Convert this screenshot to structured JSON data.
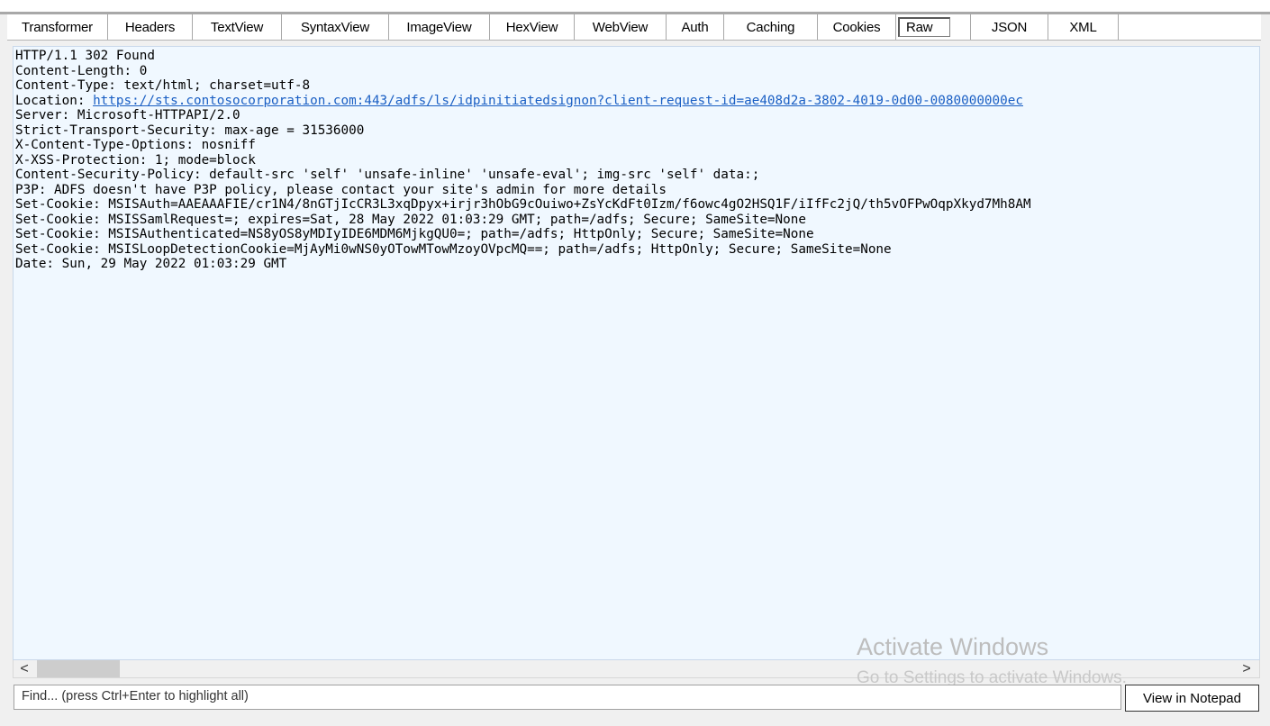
{
  "tabs": [
    {
      "label": "Transformer",
      "w": 112
    },
    {
      "label": "Headers",
      "w": 94
    },
    {
      "label": "TextView",
      "w": 99
    },
    {
      "label": "SyntaxView",
      "w": 119
    },
    {
      "label": "ImageView",
      "w": 112
    },
    {
      "label": "HexView",
      "w": 94
    },
    {
      "label": "WebView",
      "w": 102
    },
    {
      "label": "Auth",
      "w": 64
    },
    {
      "label": "Caching",
      "w": 104
    },
    {
      "label": "Cookies",
      "w": 87
    },
    {
      "label": "Raw",
      "w": 83
    },
    {
      "label": "JSON",
      "w": 86
    },
    {
      "label": "XML",
      "w": 78
    }
  ],
  "active_tab": "Raw",
  "response": {
    "status_line": "HTTP/1.1 302 Found",
    "content_length": "Content-Length: 0",
    "content_type": "Content-Type: text/html; charset=utf-8",
    "location_label": "Location: ",
    "location_url": "https://sts.contosocorporation.com:443/adfs/ls/idpinitiatedsignon?client-request-id=ae408d2a-3802-4019-0d00-0080000000ec",
    "server": "Server: Microsoft-HTTPAPI/2.0",
    "hsts": "Strict-Transport-Security: max-age = 31536000",
    "xcto": "X-Content-Type-Options: nosniff",
    "xss": "X-XSS-Protection: 1; mode=block",
    "csp": "Content-Security-Policy: default-src 'self' 'unsafe-inline' 'unsafe-eval'; img-src 'self' data:;",
    "p3p": "P3P: ADFS doesn't have P3P policy, please contact your site's admin for more details",
    "cookie1": "Set-Cookie: MSISAuth=AAEAAAFIE/cr1N4/8nGTjIcCR3L3xqDpyx+irjr3hObG9cOuiwo+ZsYcKdFt0Izm/f6owc4gO2HSQ1F/iIfFc2jQ/th5vOFPwOqpXkyd7Mh8AM",
    "cookie2": "Set-Cookie: MSISSamlRequest=; expires=Sat, 28 May 2022 01:03:29 GMT; path=/adfs; Secure; SameSite=None",
    "cookie3": "Set-Cookie: MSISAuthenticated=NS8yOS8yMDIyIDE6MDM6MjkgQU0=; path=/adfs; HttpOnly; Secure; SameSite=None",
    "cookie4": "Set-Cookie: MSISLoopDetectionCookie=MjAyMi0wNS0yOTowMTowMzoyOVpcMQ==; path=/adfs; HttpOnly; Secure; SameSite=None",
    "date": "Date: Sun, 29 May 2022 01:03:29 GMT"
  },
  "scroll": {
    "left_arrow": "<",
    "right_arrow": ">"
  },
  "watermark": {
    "title": "Activate Windows",
    "subtitle": "Go to Settings to activate Windows."
  },
  "find": {
    "placeholder": "Find... (press Ctrl+Enter to highlight all)"
  },
  "notepad_button": "View in Notepad"
}
